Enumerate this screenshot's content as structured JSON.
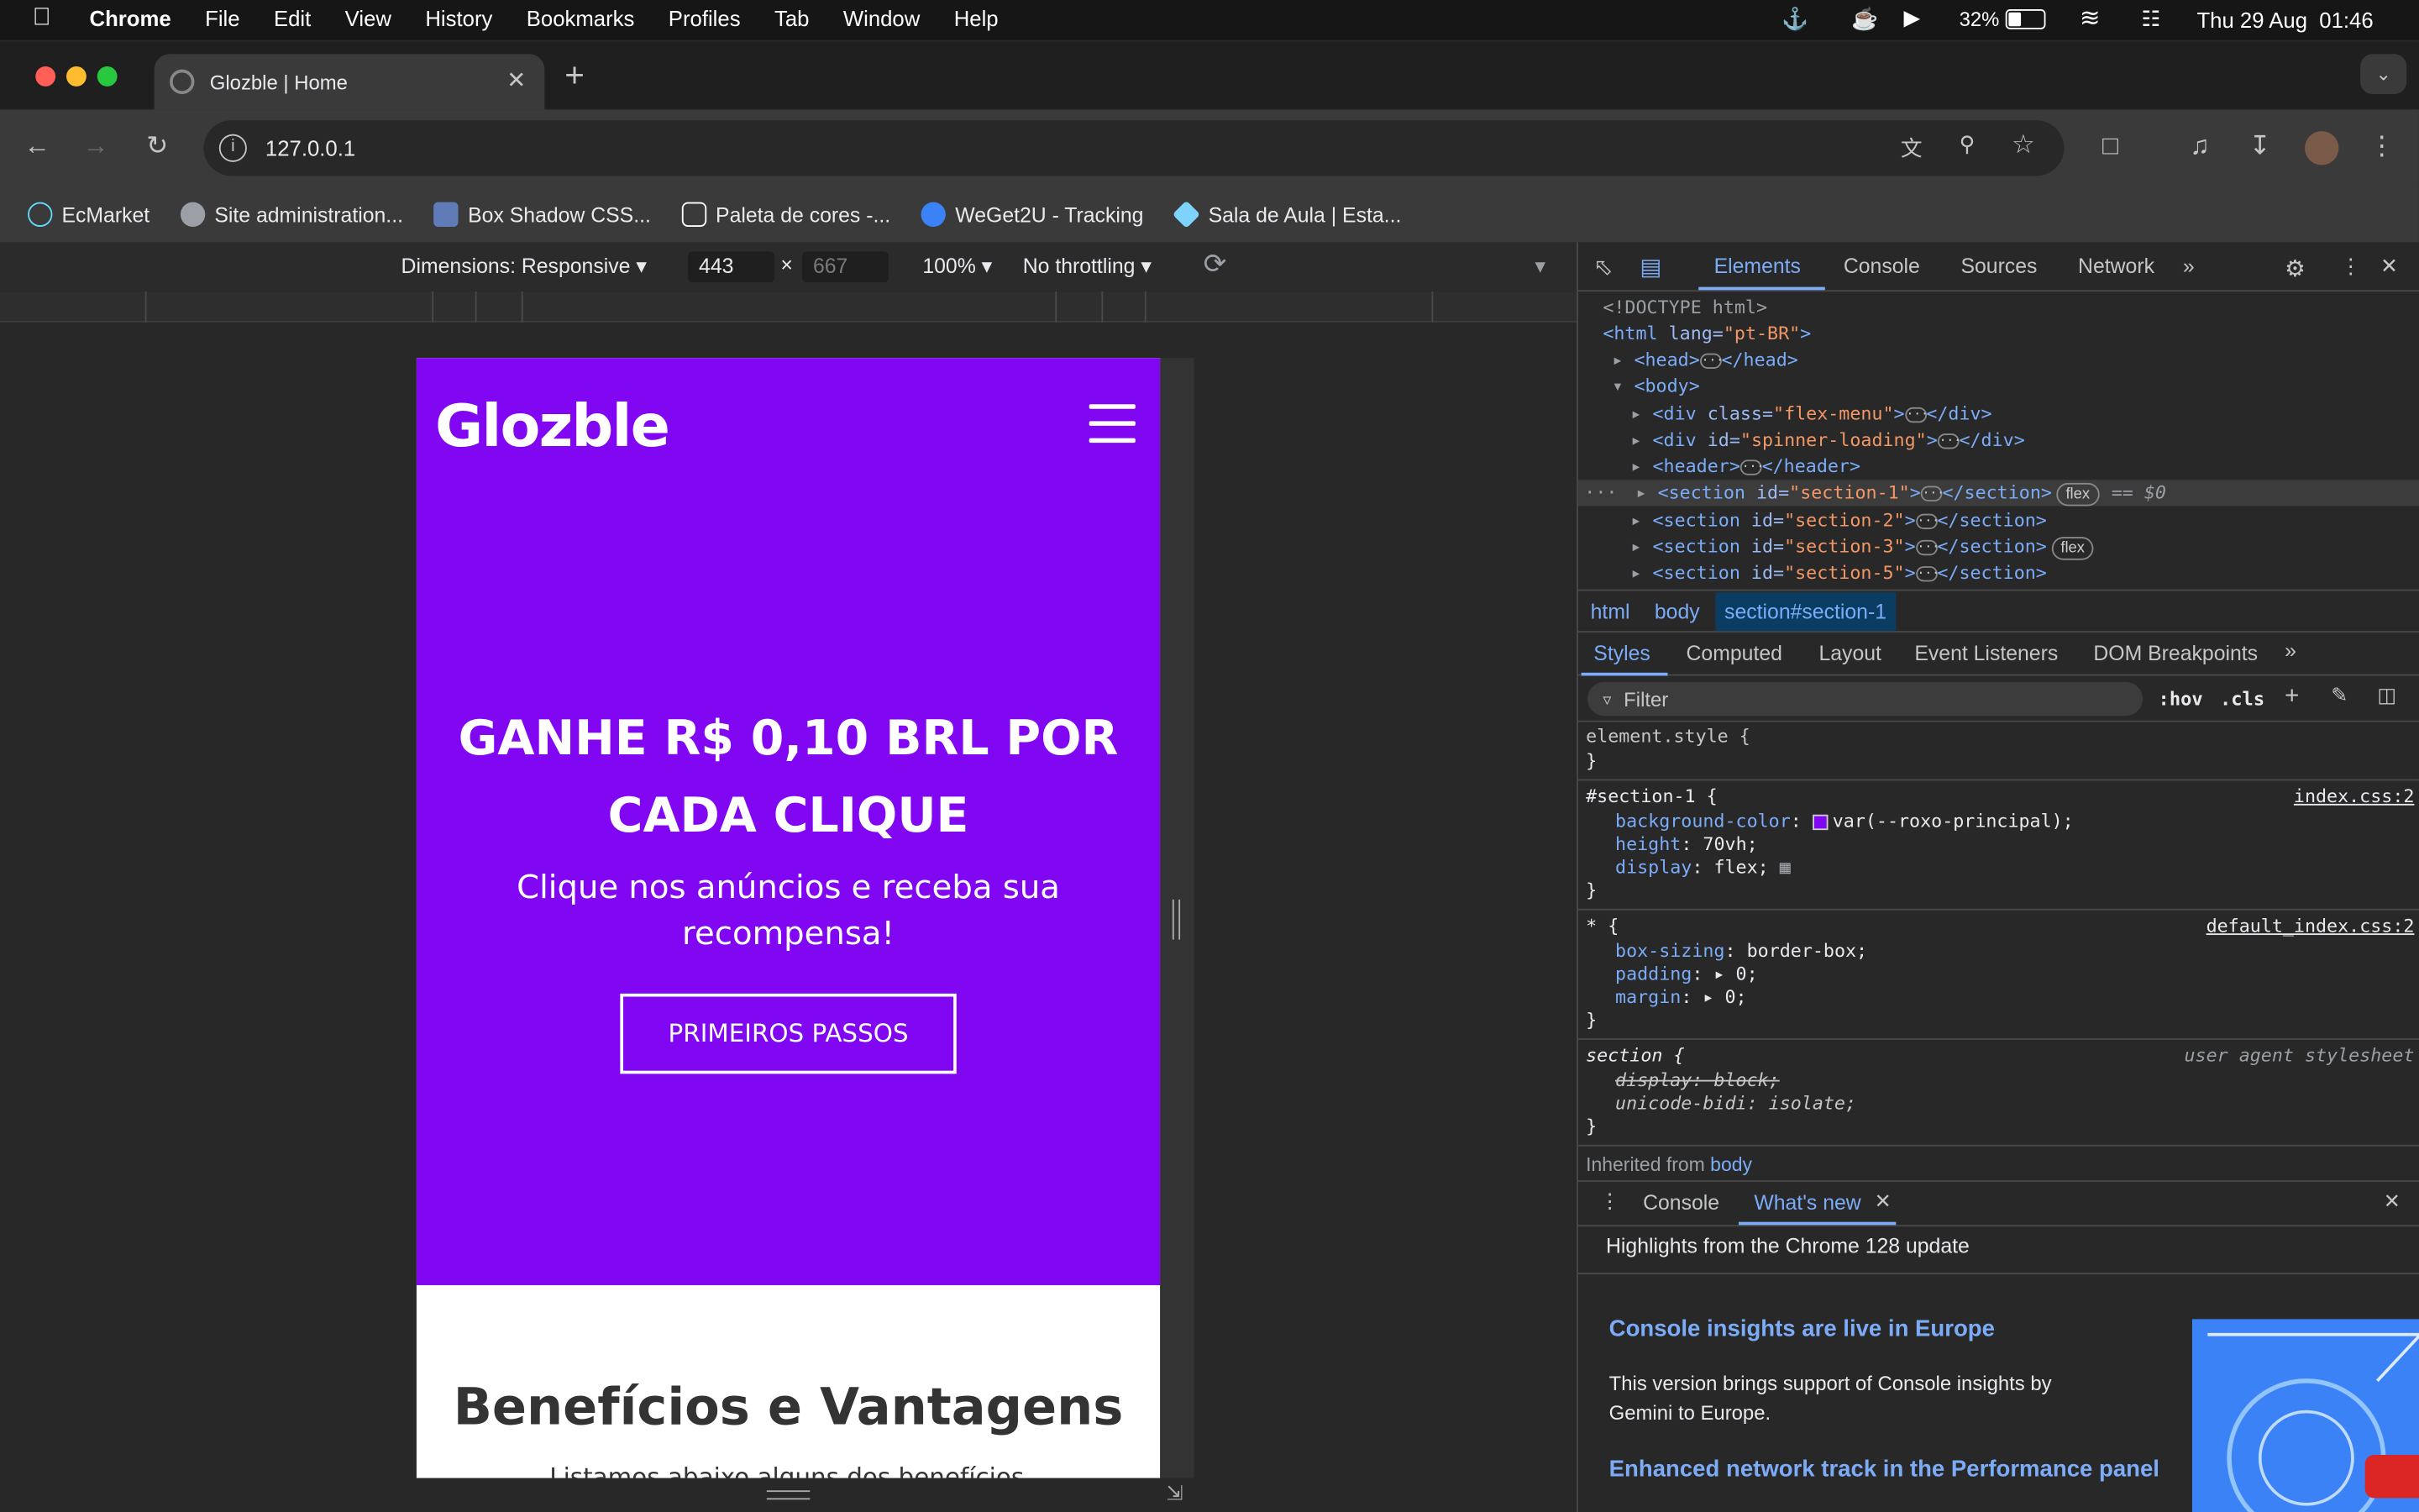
{
  "menubar": {
    "app": "Chrome",
    "items": [
      "File",
      "Edit",
      "View",
      "History",
      "Bookmarks",
      "Profiles",
      "Tab",
      "Window",
      "Help"
    ],
    "battery": "32%",
    "datetime": "Thu 29 Aug  01:46"
  },
  "tab": {
    "title": "Glozble | Home",
    "new_tab": "+"
  },
  "omnibox": {
    "url": "127.0.0.1"
  },
  "bookmarks": [
    {
      "label": "EcMarket",
      "color": "#61dafb"
    },
    {
      "label": "Site administration...",
      "color": "#9aa0a6"
    },
    {
      "label": "Box Shadow CSS...",
      "color": "#5f7bb8"
    },
    {
      "label": "Paleta de cores -...",
      "color": "#ffffff"
    },
    {
      "label": "WeGet2U - Tracking",
      "color": "#3b82f6"
    },
    {
      "label": "Sala de Aula | Esta...",
      "color": "#7dd3fc"
    }
  ],
  "device_toolbar": {
    "dimensions": "Dimensions: Responsive",
    "width": "443",
    "height": "667",
    "times": "×",
    "zoom": "100%",
    "throttling": "No throttling"
  },
  "site": {
    "logo": "Glozble",
    "hero_title": "GANHE R$ 0,10 BRL POR CADA CLIQUE",
    "hero_subtitle": "Clique nos anúncios e receba sua recompensa!",
    "hero_button": "PRIMEIROS PASSOS",
    "section2_title": "Benefícios e Vantagens",
    "section2_text": "Listamos abaixo alguns dos benefícios",
    "accent": "#8107f2"
  },
  "devtools": {
    "tabs": [
      "Elements",
      "Console",
      "Sources",
      "Network"
    ],
    "active_tab": "Elements",
    "dom": {
      "doctype": "<!DOCTYPE html>",
      "html_open": "<html",
      "html_attr": " lang=",
      "html_val": "\"pt-BR\"",
      "html_close": ">",
      "head": "<head>",
      "head_end": "</head>",
      "body": "<body>",
      "div1_attr": " class=",
      "div1_val": "\"flex-menu\"",
      "div2_attr": " id=",
      "div2_val": "\"spinner-loading\"",
      "header": "<header>",
      "header_end": "</header>",
      "sec1": "\"section-1\"",
      "sec2": "\"section-2\"",
      "sec3": "\"section-3\"",
      "sec5": "\"section-5\"",
      "flex": "flex",
      "eq": "== $0"
    },
    "breadcrumbs": [
      "html",
      "body",
      "section#section-1"
    ],
    "subtabs": [
      "Styles",
      "Computed",
      "Layout",
      "Event Listeners",
      "DOM Breakpoints"
    ],
    "filter_placeholder": "Filter",
    "hov": ":hov",
    "cls": ".cls",
    "styles": {
      "element_style": "element.style {",
      "close": "}",
      "rule1_selector": "#section-1 {",
      "rule1_source": "index.css:2",
      "bg_prop": "background-color",
      "bg_val": "var(--roxo-principal);",
      "height_prop": "height",
      "height_val": "70vh;",
      "display_prop": "display",
      "display_val": "flex;",
      "rule2_selector": "* {",
      "rule2_source": "default_index.css:2",
      "box_prop": "box-sizing",
      "box_val": "border-box;",
      "padding_prop": "padding",
      "padding_val": "0;",
      "margin_prop": "margin",
      "margin_val": "0;",
      "rule3_selector": "section {",
      "rule3_source": "user agent stylesheet",
      "ua_display": "display: block;",
      "ua_bidi": "unicode-bidi: isolate;",
      "inherited": "Inherited from",
      "inherited_el": "body"
    },
    "drawer": {
      "tab1": "Console",
      "tab2": "What's new",
      "highlights": "Highlights from the Chrome 128 update",
      "h1": "Console insights are live in Europe",
      "p1": "This version brings support of Console insights by Gemini to Europe.",
      "h2": "Enhanced network track in the Performance panel"
    }
  }
}
